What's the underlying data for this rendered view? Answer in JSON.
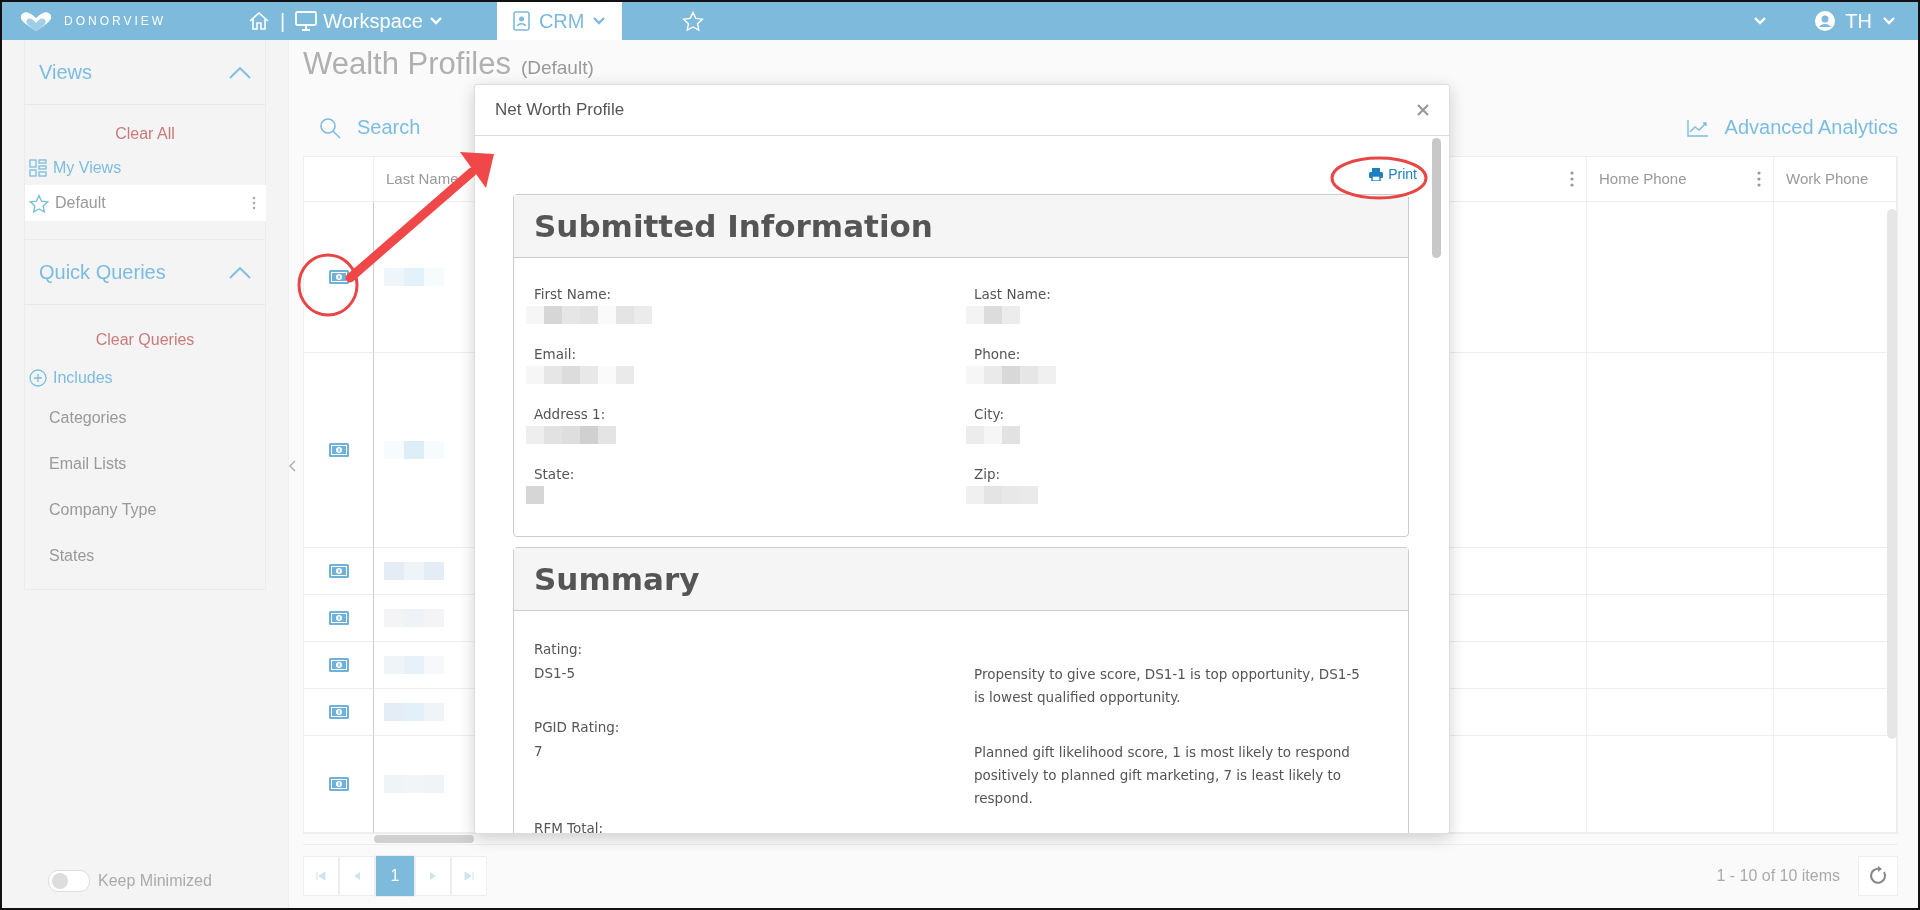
{
  "top_bar": {
    "logo": "DONORVIEW",
    "separator": "|",
    "workspace": "Workspace",
    "tabs": [
      {
        "label": "CRM",
        "selected": true
      }
    ],
    "user": "TH"
  },
  "sidebar": {
    "views": {
      "title": "Views",
      "expanded": true,
      "clear": "Clear All",
      "my_views": "My Views",
      "items": [
        {
          "label": "Default",
          "selected": true
        }
      ]
    },
    "quick_queries": {
      "title": "Quick Queries",
      "expanded": true,
      "clear": "Clear Queries",
      "includes": "Includes",
      "items": [
        "Categories",
        "Email Lists",
        "Company Type",
        "States"
      ]
    },
    "keep_minimized": {
      "label": "Keep Minimized",
      "on": false
    }
  },
  "page": {
    "title": "Wealth Profiles",
    "subtitle": "(Default)",
    "search_placeholder": "Search",
    "analytics": "Advanced Analytics"
  },
  "table": {
    "columns": [
      {
        "label": "Last Name"
      },
      {
        "label": "Home Phone"
      },
      {
        "label": "Work Phone"
      }
    ],
    "rows": [
      {
        "redacted": true
      },
      {
        "redacted": true
      },
      {
        "redacted": true
      },
      {
        "redacted": true
      },
      {
        "redacted": true
      },
      {
        "redacted": true
      },
      {
        "redacted": true
      }
    ]
  },
  "pagination": {
    "pages": [
      {
        "label": "1",
        "selected": true
      }
    ],
    "summary": "1 - 10 of 10 items"
  },
  "modal": {
    "title": "Net Worth Profile",
    "print": "Print",
    "sections": [
      {
        "title": "Submitted Information",
        "kind": "grid",
        "fields": [
          {
            "label": "First Name:",
            "redacted": true
          },
          {
            "label": "Last Name:",
            "redacted": true
          },
          {
            "label": "Email:",
            "redacted": true
          },
          {
            "label": "Phone:",
            "redacted": true
          },
          {
            "label": "Address 1:",
            "redacted": true
          },
          {
            "label": "City:",
            "redacted": true
          },
          {
            "label": "State:",
            "redacted": true
          },
          {
            "label": "Zip:",
            "redacted": true
          }
        ]
      },
      {
        "title": "Summary",
        "kind": "notes",
        "fields": [
          {
            "label": "Rating:",
            "value": "DS1-5",
            "note": "Propensity to give score, DS1-1 is top opportunity, DS1-5 is lowest qualified opportunity."
          },
          {
            "label": "PGID Rating:",
            "value": "7",
            "note": "Planned gift likelihood score, 1 is most likely to respond positively to planned gift marketing, 7 is least likely to respond."
          },
          {
            "label": "RFM Total:"
          }
        ]
      }
    ]
  }
}
